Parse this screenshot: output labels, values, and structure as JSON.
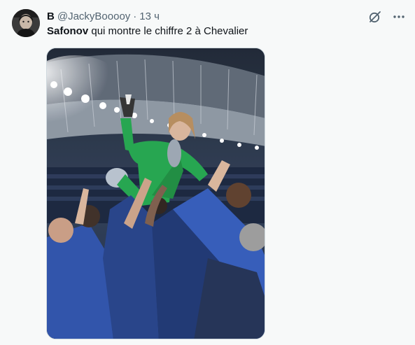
{
  "author": {
    "display_name": "В",
    "handle": "@JackyBooooy",
    "separator": "·",
    "time": "13 ч"
  },
  "tweet": {
    "bold_text": "Safonov",
    "text": " qui montre le chiffre 2 à Chevalier"
  },
  "icons": {
    "grok": "grok-icon",
    "more": "more-icon"
  },
  "colors": {
    "secondary_text": "#536471",
    "primary_text": "#0f1419",
    "background": "#f7f9f9",
    "media_border": "#cfd9de",
    "goalkeeper_kit": "#1fa34a",
    "team_blue": "#2a4fa8"
  }
}
